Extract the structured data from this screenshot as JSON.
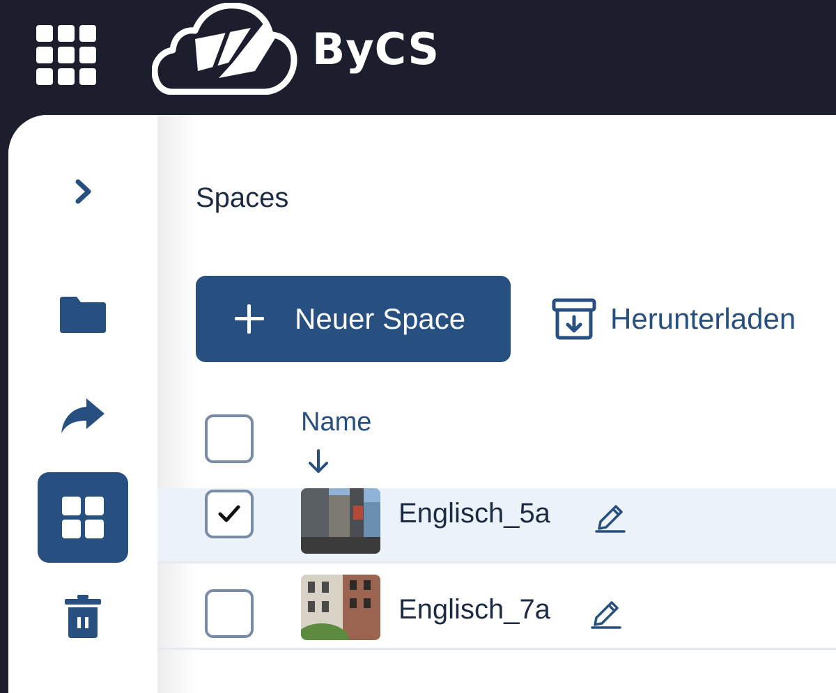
{
  "app": {
    "brand": "ByCS"
  },
  "page": {
    "title": "Spaces"
  },
  "toolbar": {
    "new_space_label": "Neuer Space",
    "download_label": "Herunterladen"
  },
  "table": {
    "column_name": "Name",
    "sort": "descending",
    "rows": [
      {
        "name": "Englisch_5a",
        "selected": true
      },
      {
        "name": "Englisch_7a",
        "selected": false
      }
    ]
  },
  "sidebar": {
    "items": [
      {
        "icon": "chevron-right-icon"
      },
      {
        "icon": "folder-icon"
      },
      {
        "icon": "share-icon"
      },
      {
        "icon": "spaces-grid-icon",
        "active": true
      },
      {
        "icon": "trash-icon"
      }
    ]
  },
  "colors": {
    "topbar": "#1c1e2e",
    "primary": "#274f80",
    "selected_row": "#ecf2fa"
  }
}
